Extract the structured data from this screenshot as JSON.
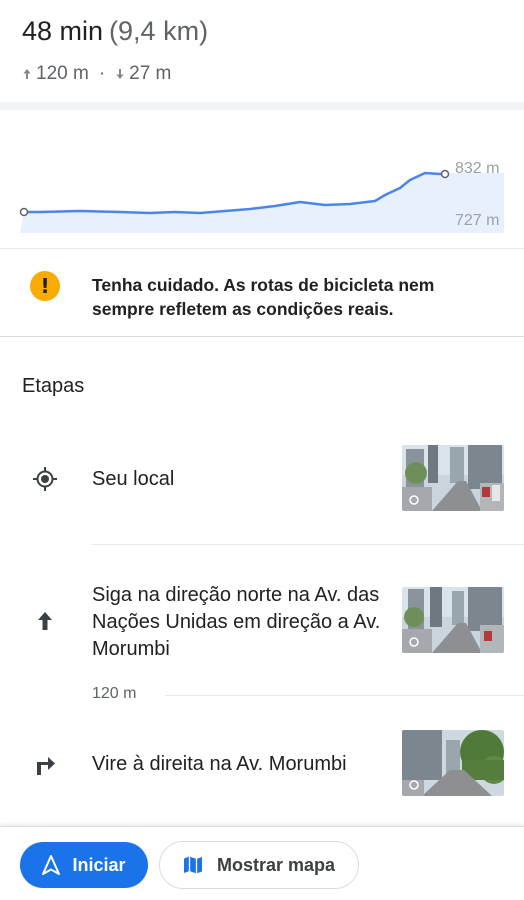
{
  "route": {
    "duration": "48 min",
    "distance": "(9,4 km)",
    "ascent": "120 m",
    "separator": "·",
    "descent": "27 m"
  },
  "elevation_chart": {
    "max_label": "832 m",
    "min_label": "727 m",
    "fill_color": "#e8f0fe",
    "line_color": "#4a86e8"
  },
  "warning": {
    "icon": "exclamation-icon",
    "text": "Tenha cuidado. As rotas de bicicleta nem sempre refletem as condições reais."
  },
  "steps_section": {
    "title": "Etapas",
    "steps": [
      {
        "icon": "my-location-icon",
        "text": "Seu local"
      },
      {
        "icon": "arrow-up-icon",
        "text": "Siga na direção norte na Av. das Nações Unidas em direção a Av. Morumbi",
        "distance": "120 m"
      },
      {
        "icon": "turn-right-icon",
        "text": "Vire à direita na Av. Morumbi"
      }
    ]
  },
  "actions": {
    "start_label": "Iniciar",
    "map_label": "Mostrar mapa",
    "accent": "#1a73e8"
  }
}
